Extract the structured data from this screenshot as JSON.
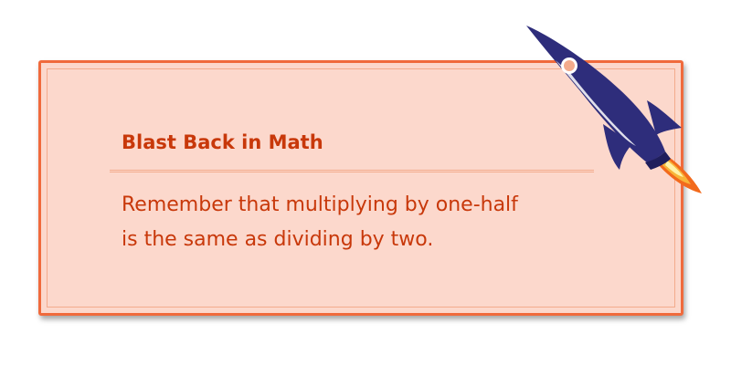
{
  "card": {
    "title": "Blast Back in Math",
    "body_lines": [
      "Remember that multiplying by one-half",
      "is the same as dividing by two."
    ]
  },
  "decoration": {
    "icon": "rocket-icon"
  },
  "colors": {
    "card_background": "#fcd8cc",
    "card_border": "#f06a3c",
    "text": "#c8380a",
    "rocket_body": "#2e2d7b",
    "flame": "#f5a02a"
  }
}
